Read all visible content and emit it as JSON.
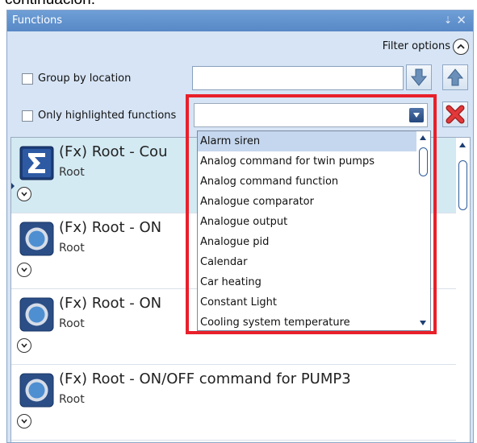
{
  "doc_text": {
    "cut_heading": "continuación:"
  },
  "window": {
    "title": "Functions",
    "pin_icon": "pin-icon",
    "close_icon": "close-icon"
  },
  "filters": {
    "filter_options_label": "Filter options",
    "group_by_location_label": "Group by location",
    "group_by_location_checked": false,
    "location_value": "",
    "only_highlighted_label": "Only highlighted functions",
    "only_highlighted_checked": false,
    "function_select_value": "",
    "buttons": {
      "down": "arrow-down-icon",
      "up": "arrow-up-icon",
      "clear": "red-x-icon"
    }
  },
  "functions": [
    {
      "title": "(Fx) Root - Cou",
      "location": "Root",
      "icon": "sigma-icon",
      "selected": true
    },
    {
      "title": "(Fx) Root - ON",
      "location": "Root",
      "icon": "pump-icon",
      "selected": false
    },
    {
      "title": "(Fx) Root - ON",
      "location": "Root",
      "icon": "pump-icon",
      "selected": false
    },
    {
      "title": "(Fx) Root - ON/OFF command for PUMP3",
      "location": "Root",
      "icon": "pump-icon",
      "selected": false
    }
  ],
  "dropdown_options": [
    "Alarm siren",
    "Analog command for twin pumps",
    "Analog command function",
    "Analogue comparator",
    "Analogue output",
    "Analogue pid",
    "Calendar",
    "Car heating",
    "Constant Light",
    "Cooling system temperature"
  ],
  "colors": {
    "panel_bg": "#d6e4f5",
    "titlebar": "#5e8fcc",
    "selected_row": "#d3eaf3",
    "highlight_frame": "#e8202a",
    "hover_item": "#c5d7ee"
  }
}
